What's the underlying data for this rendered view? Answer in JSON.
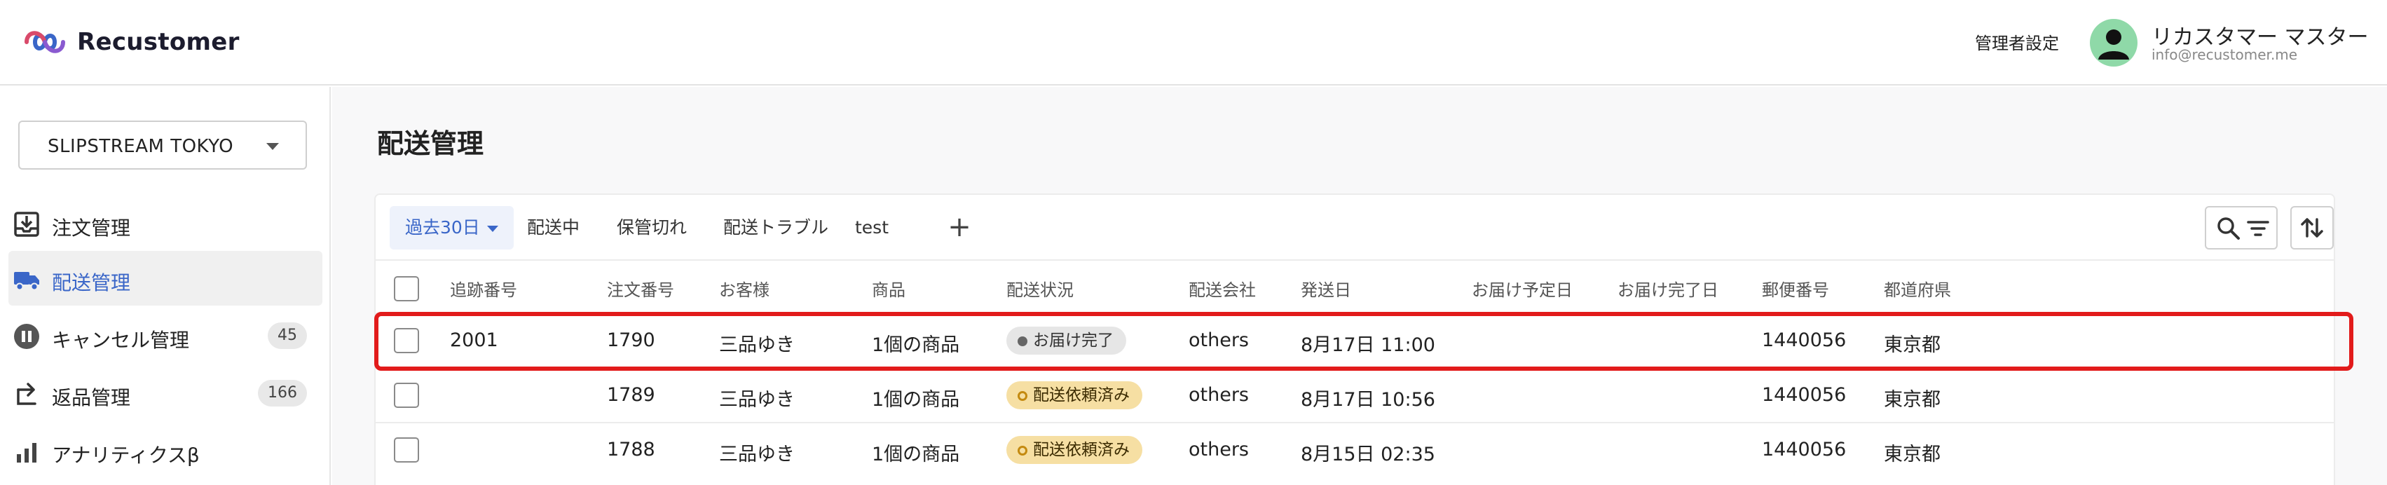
{
  "header": {
    "brand": "Recustomer",
    "admin_settings": "管理者設定",
    "user_name": "リカスタマー マスター",
    "user_email": "info@recustomer.me"
  },
  "sidebar": {
    "store": "SLIPSTREAM TOKYO",
    "items": [
      {
        "label": "注文管理",
        "icon": "inbox-download-icon"
      },
      {
        "label": "配送管理",
        "icon": "truck-icon"
      },
      {
        "label": "キャンセル管理",
        "icon": "pause-circle-icon",
        "badge": "45"
      },
      {
        "label": "返品管理",
        "icon": "return-arrow-icon",
        "badge": "166"
      },
      {
        "label": "アナリティクスβ",
        "icon": "bar-chart-icon"
      }
    ]
  },
  "main": {
    "title": "配送管理",
    "tabs": [
      {
        "label": "過去30日"
      },
      {
        "label": "配送中"
      },
      {
        "label": "保管切れ"
      },
      {
        "label": "配送トラブル"
      },
      {
        "label": "test"
      }
    ],
    "add_tab_label": "+",
    "columns": [
      "追跡番号",
      "注文番号",
      "お客様",
      "商品",
      "配送状況",
      "配送会社",
      "発送日",
      "お届け予定日",
      "お届け完了日",
      "郵便番号",
      "都道府県"
    ],
    "rows": [
      {
        "tracking": "2001",
        "order": "1790",
        "customer": "三品ゆき",
        "product": "1個の商品",
        "status": "お届け完了",
        "status_type": "done",
        "carrier": "others",
        "ship_date": "8月17日 11:00",
        "eta": "",
        "delivered": "",
        "postal": "1440056",
        "prefecture": "東京都"
      },
      {
        "tracking": "",
        "order": "1789",
        "customer": "三品ゆき",
        "product": "1個の商品",
        "status": "配送依頼済み",
        "status_type": "requested",
        "carrier": "others",
        "ship_date": "8月17日 10:56",
        "eta": "",
        "delivered": "",
        "postal": "1440056",
        "prefecture": "東京都"
      },
      {
        "tracking": "",
        "order": "1788",
        "customer": "三品ゆき",
        "product": "1個の商品",
        "status": "配送依頼済み",
        "status_type": "requested",
        "carrier": "others",
        "ship_date": "8月15日 02:35",
        "eta": "",
        "delivered": "",
        "postal": "1440056",
        "prefecture": "東京都"
      }
    ]
  },
  "colors": {
    "accent": "#3a66c8",
    "highlight": "#e21b1b",
    "pill_requested": "#f6dfa3",
    "pill_done": "#e6e6e6"
  }
}
